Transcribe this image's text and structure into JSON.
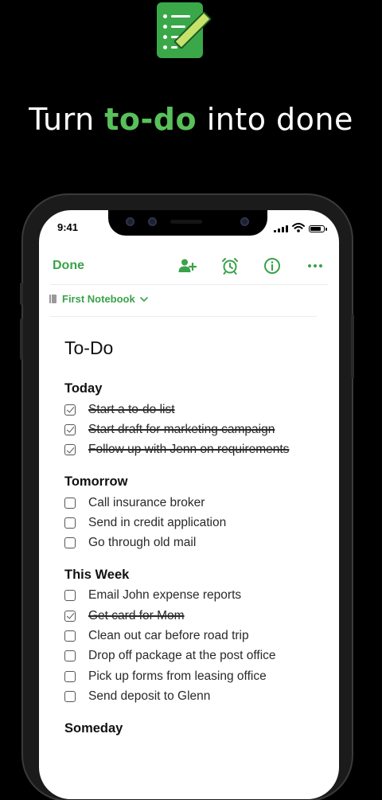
{
  "headline": {
    "before": "Turn ",
    "highlight": "to-do",
    "after": " into done"
  },
  "status": {
    "time": "9:41"
  },
  "toolbar": {
    "done_label": "Done"
  },
  "notebook": {
    "label": "First Notebook"
  },
  "note": {
    "title": "To-Do"
  },
  "sections": [
    {
      "title": "Today",
      "tasks": [
        {
          "text": "Start a to-do list",
          "done": true
        },
        {
          "text": "Start draft for marketing campaign",
          "done": true
        },
        {
          "text": "Follow up with Jenn on requirements",
          "done": true
        }
      ]
    },
    {
      "title": "Tomorrow",
      "tasks": [
        {
          "text": "Call insurance broker",
          "done": false
        },
        {
          "text": "Send in credit application",
          "done": false
        },
        {
          "text": "Go through old mail",
          "done": false
        }
      ]
    },
    {
      "title": "This Week",
      "tasks": [
        {
          "text": "Email John expense reports",
          "done": false
        },
        {
          "text": "Get card for Mom",
          "done": true
        },
        {
          "text": "Clean out car before road trip",
          "done": false
        },
        {
          "text": "Drop off package at the post office",
          "done": false
        },
        {
          "text": "Pick up forms from leasing office",
          "done": false
        },
        {
          "text": "Send deposit to Glenn",
          "done": false
        }
      ]
    },
    {
      "title": "Someday",
      "tasks": []
    }
  ],
  "icons": [
    "app-logo-icon",
    "add-user-icon",
    "alarm-clock-icon",
    "info-icon",
    "more-icon",
    "notebook-icon",
    "chevron-down-icon",
    "signal-icon",
    "wifi-icon",
    "battery-icon"
  ],
  "colors": {
    "accent": "#3aa24a",
    "background": "#000000",
    "app_icon": "#3aa849"
  },
  "battery_level": 0.85
}
